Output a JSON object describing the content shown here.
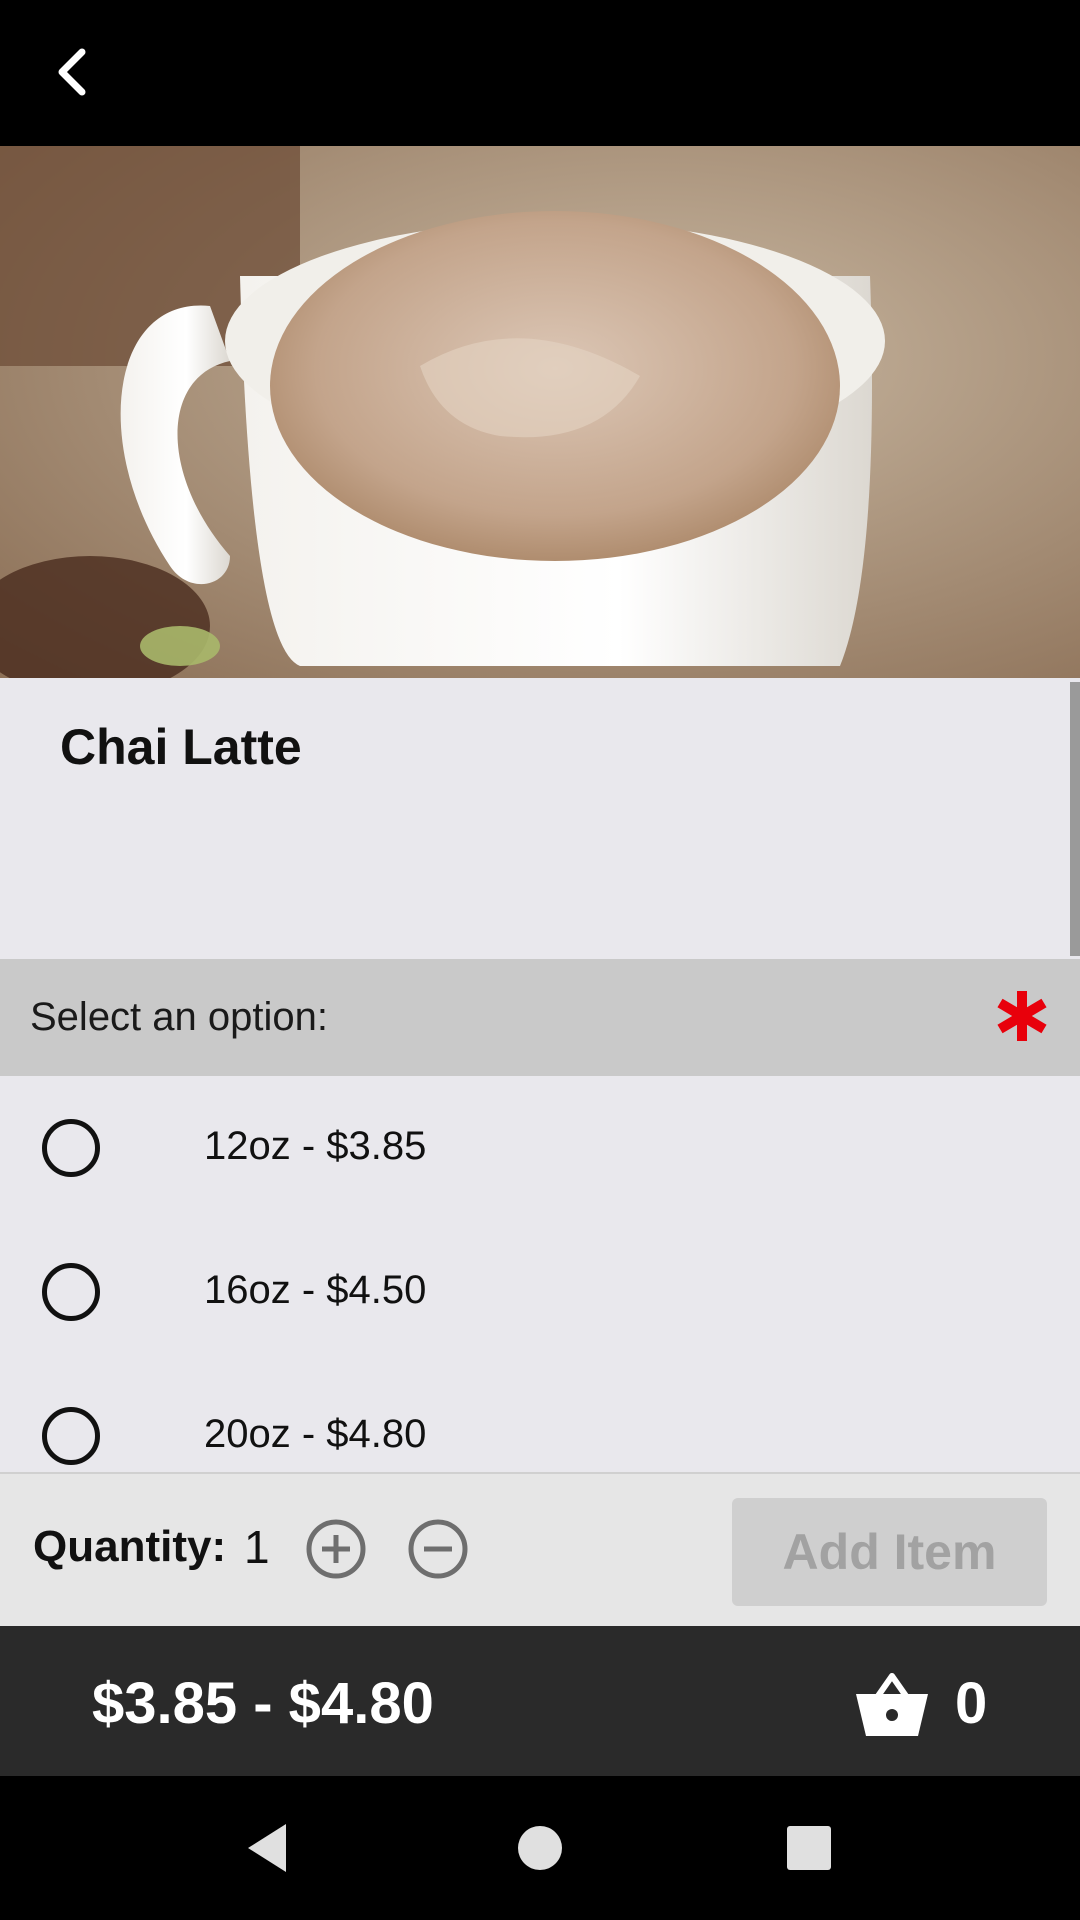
{
  "header": {
    "back_icon": "chevron-left-icon"
  },
  "product": {
    "image_description_icon": "chai-latte-photo",
    "title": "Chai Latte"
  },
  "options": {
    "header_label": "Select an option:",
    "required_icon": "asterisk-icon",
    "required_color": "#e8000b",
    "items": [
      {
        "label": "12oz - $3.85",
        "selected": false
      },
      {
        "label": "16oz - $4.50",
        "selected": false
      },
      {
        "label": "20oz - $4.80",
        "selected": false
      }
    ]
  },
  "quantity": {
    "label": "Quantity:",
    "value": "1",
    "plus_icon": "plus-circle-icon",
    "minus_icon": "minus-circle-icon",
    "add_label": "Add Item"
  },
  "footer": {
    "price_range": "$3.85 - $4.80",
    "cart_icon": "basket-icon",
    "cart_count": "0"
  },
  "system_nav": {
    "back_icon": "nav-back-icon",
    "home_icon": "nav-home-icon",
    "recent_icon": "nav-recents-icon"
  },
  "colors": {
    "background": "#e9e8ed",
    "option_header": "#c9c9c9",
    "footer": "#2a2a2a",
    "add_button": "#cfcfcf",
    "add_button_text": "#a2a2a2"
  }
}
